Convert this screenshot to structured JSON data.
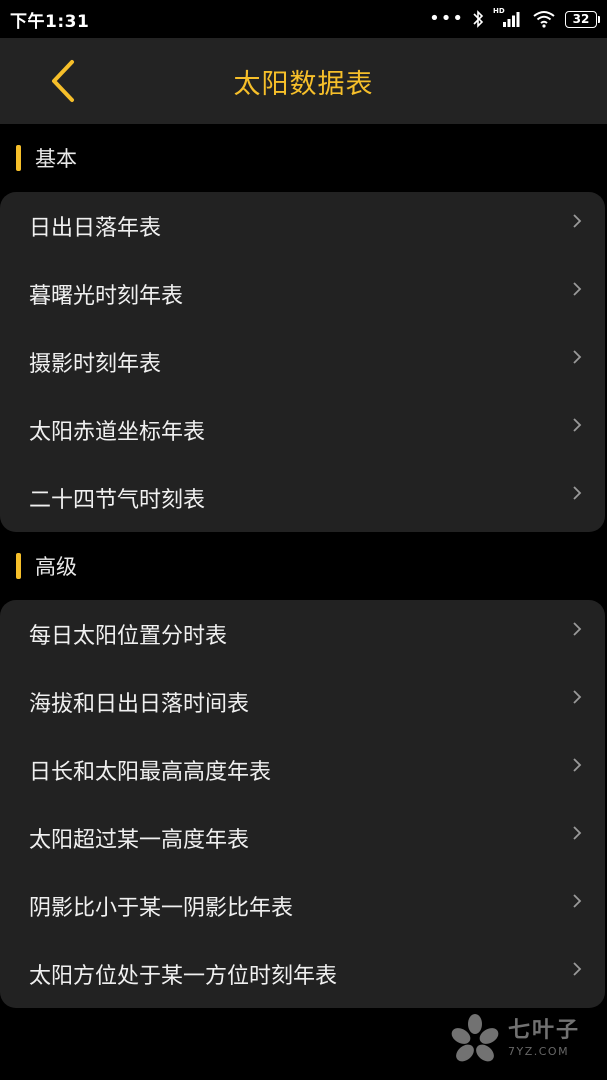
{
  "status_bar": {
    "time": "下午1:31",
    "hd_label": "HD",
    "battery": "32"
  },
  "header": {
    "title": "太阳数据表"
  },
  "sections": [
    {
      "label": "基本",
      "items": [
        {
          "label": "日出日落年表"
        },
        {
          "label": "暮曙光时刻年表"
        },
        {
          "label": "摄影时刻年表"
        },
        {
          "label": "太阳赤道坐标年表"
        },
        {
          "label": "二十四节气时刻表"
        }
      ]
    },
    {
      "label": "高级",
      "items": [
        {
          "label": "每日太阳位置分时表"
        },
        {
          "label": "海拔和日出日落时间表"
        },
        {
          "label": "日长和太阳最高高度年表"
        },
        {
          "label": "太阳超过某一高度年表"
        },
        {
          "label": "阴影比小于某一阴影比年表"
        },
        {
          "label": "太阳方位处于某一方位时刻年表"
        }
      ]
    }
  ],
  "watermark": {
    "main": "七叶子",
    "sub": "7YZ.COM"
  },
  "colors": {
    "accent": "#f6bf2a",
    "background": "#000000",
    "card": "#222222",
    "header": "#232323"
  }
}
